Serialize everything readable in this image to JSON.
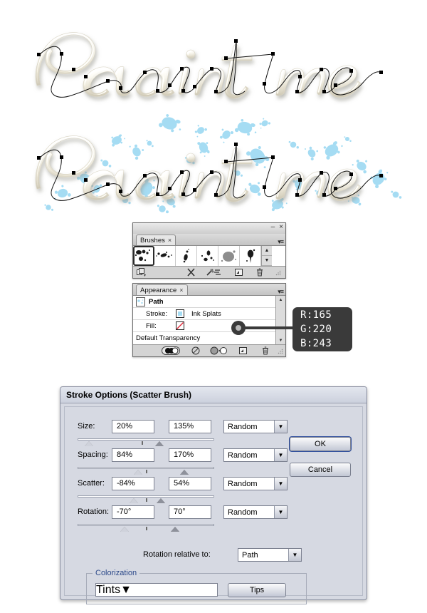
{
  "artwork": {
    "text": "Paint me",
    "first_label": "plain-script-with-path",
    "second_label": "script-with-ink-splat-scatter-brush",
    "script_fill": "#efece2",
    "splat_color": "#a5dcf3"
  },
  "brushes_panel": {
    "tab_label": "Brushes",
    "tab_close": "×",
    "minimize": "–",
    "close": "×",
    "menu_icon": "panel-menu-icon",
    "brushes": [
      {
        "name": "ink-splat-brush-1",
        "selected": true
      },
      {
        "name": "ink-splat-brush-2",
        "selected": false
      },
      {
        "name": "ink-splat-brush-3",
        "selected": false
      },
      {
        "name": "ink-splat-brush-4",
        "selected": false
      },
      {
        "name": "ink-blob-brush-5",
        "selected": false
      },
      {
        "name": "ink-drip-brush-6",
        "selected": false
      }
    ],
    "scroll_up": "▲",
    "scroll_down": "▼",
    "toolbar_icons": [
      "brush-libraries-icon",
      "remove-brush-stroke-icon",
      "options-of-selected-object-icon",
      "new-brush-icon",
      "delete-brush-icon"
    ]
  },
  "appearance_panel": {
    "tab_label": "Appearance",
    "tab_close": "×",
    "menu_icon": "panel-menu-icon",
    "title": "Path",
    "rows": [
      {
        "label": "Stroke:",
        "value": "Ink Splats",
        "swatch": "#a5dcf3"
      },
      {
        "label": "Fill:",
        "value": "",
        "swatch": "none"
      }
    ],
    "transparency_row": "Default Transparency",
    "toolbar_icons": [
      "add-new-stroke-icon",
      "clear-appearance-icon",
      "reduce-to-basic-appearance-icon",
      "duplicate-selected-item-icon",
      "delete-selected-item-icon"
    ]
  },
  "color_callout": {
    "r": "R:165",
    "g": "G:220",
    "b": "B:243",
    "hex": "#a5dcf3"
  },
  "dialog": {
    "title": "Stroke Options (Scatter Brush)",
    "rows": [
      {
        "name": "size",
        "label": "Size:",
        "min_value": "20%",
        "max_value": "135%",
        "mode": "Random",
        "slider": {
          "thumb1_pct": 5,
          "thumb2_pct": 57,
          "tick_pct": 47
        }
      },
      {
        "name": "spacing",
        "label": "Spacing:",
        "min_value": "84%",
        "max_value": "170%",
        "mode": "Random",
        "slider": {
          "thumb1_pct": 41,
          "thumb2_pct": 75,
          "tick_pct": 50
        }
      },
      {
        "name": "scatter",
        "label": "Scatter:",
        "min_value": "-84%",
        "max_value": "54%",
        "mode": "Random",
        "slider": {
          "thumb1_pct": 38,
          "thumb2_pct": 58,
          "tick_pct": 50
        }
      },
      {
        "name": "rotation",
        "label": "Rotation:",
        "min_value": "-70°",
        "max_value": "70°",
        "mode": "Random",
        "slider": {
          "thumb1_pct": 31,
          "thumb2_pct": 68,
          "tick_pct": 50
        }
      }
    ],
    "rotation_relative": {
      "label": "Rotation relative to:",
      "value": "Path"
    },
    "colorization": {
      "legend": "Colorization",
      "method": "Tints",
      "tips_button": "Tips"
    },
    "buttons": {
      "ok": "OK",
      "cancel": "Cancel"
    },
    "dropdown_arrow": "▼"
  }
}
